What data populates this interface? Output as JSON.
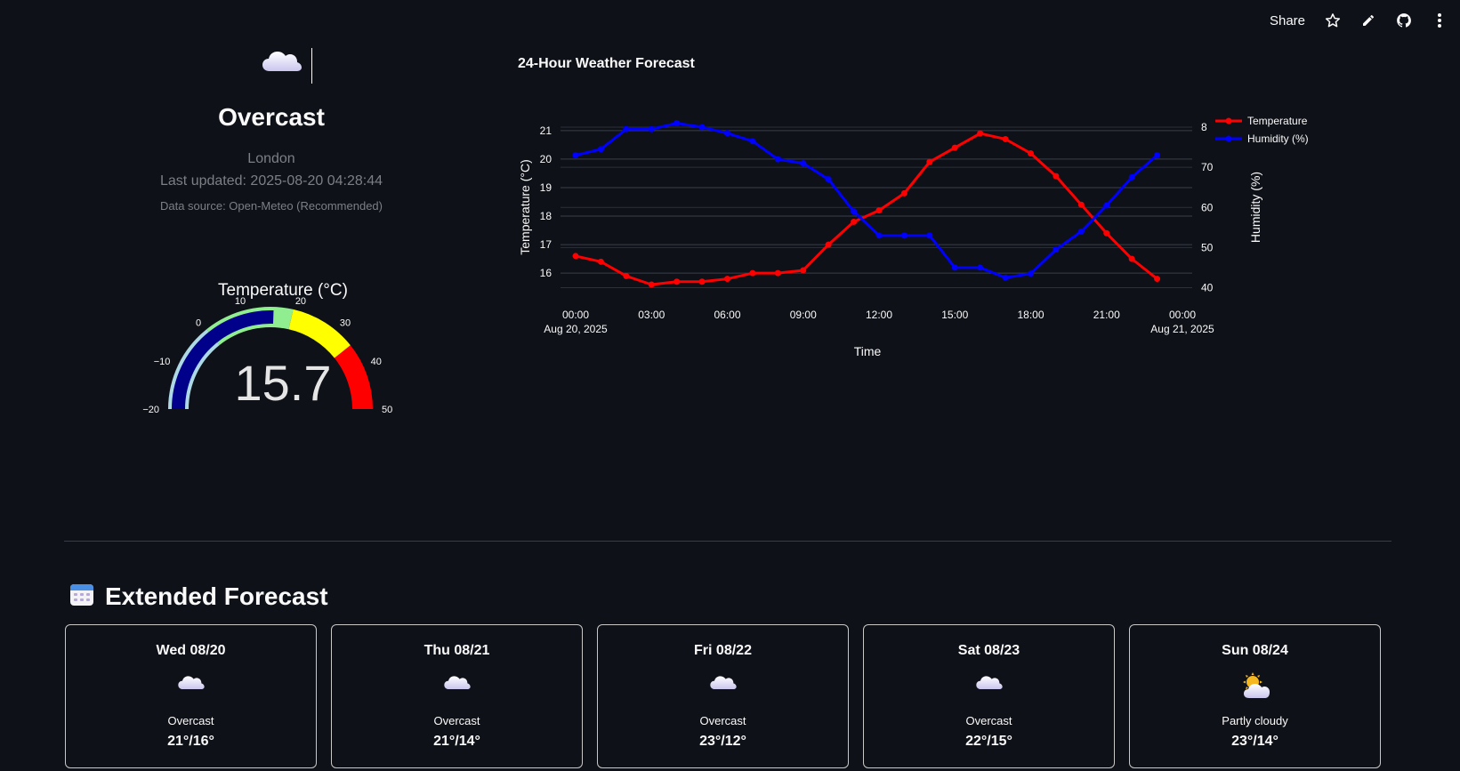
{
  "toolbar": {
    "share_label": "Share",
    "icons": [
      "star-icon",
      "edit-icon",
      "github-icon",
      "more-vert-icon"
    ]
  },
  "current": {
    "icon": "cloud-icon",
    "condition": "Overcast",
    "city": "London",
    "last_updated": "Last updated: 2025-08-20 04:28:44",
    "data_source": "Data source: Open-Meteo (Recommended)"
  },
  "gauge": {
    "title": "Temperature (°C)",
    "value": 15.7,
    "value_label": "15.7",
    "min": -20,
    "max": 50,
    "tick_labels": [
      "−20",
      "−10",
      "0",
      "10",
      "20",
      "30",
      "40",
      "50"
    ],
    "bands": [
      {
        "from": -20,
        "to": 0,
        "color": "#add8e6"
      },
      {
        "from": 0,
        "to": 20,
        "color": "#90ee90"
      },
      {
        "from": 20,
        "to": 35,
        "color": "#ffff00"
      },
      {
        "from": 35,
        "to": 50,
        "color": "#ff0000"
      }
    ],
    "bar_color": "#00008b"
  },
  "chart_title": "24-Hour Weather Forecast",
  "chart_data": {
    "type": "line",
    "title": "24-Hour Weather Forecast",
    "xlabel": "Time",
    "ylabel": "Temperature (°C)",
    "y2label": "Humidity (%)",
    "x": [
      "00:00",
      "01:00",
      "02:00",
      "03:00",
      "04:00",
      "05:00",
      "06:00",
      "07:00",
      "08:00",
      "09:00",
      "10:00",
      "11:00",
      "12:00",
      "13:00",
      "14:00",
      "15:00",
      "16:00",
      "17:00",
      "18:00",
      "19:00",
      "20:00",
      "21:00",
      "22:00",
      "23:00"
    ],
    "x_tick_labels": [
      "00:00",
      "03:00",
      "06:00",
      "09:00",
      "12:00",
      "15:00",
      "18:00",
      "21:00",
      "00:00"
    ],
    "x_tick_sublabels": [
      "Aug 20, 2025",
      "",
      "",
      "",
      "",
      "",
      "",
      "",
      "Aug 21, 2025"
    ],
    "ylim": [
      15.35,
      21.4
    ],
    "y_ticks": [
      16,
      17,
      18,
      19,
      20,
      21
    ],
    "y2lim": [
      39,
      82
    ],
    "y2_ticks": [
      40,
      50,
      60,
      70,
      80
    ],
    "y2_tick_labels": [
      "40",
      "50",
      "60",
      "70",
      "8"
    ],
    "legend_position": "top-right",
    "grid": true,
    "series": [
      {
        "name": "Temperature (°C)",
        "axis": "y",
        "color": "#ff0000",
        "values": [
          16.6,
          16.4,
          15.9,
          15.6,
          15.7,
          15.7,
          15.8,
          16.0,
          16.0,
          16.1,
          17.0,
          17.8,
          18.2,
          18.8,
          19.9,
          20.4,
          20.9,
          20.7,
          20.2,
          19.4,
          18.4,
          17.4,
          16.5,
          15.8
        ]
      },
      {
        "name": "Humidity (%)",
        "axis": "y2",
        "color": "#0000ff",
        "values": [
          73,
          74.5,
          79.5,
          79.5,
          81,
          80,
          78.5,
          76.5,
          72,
          71,
          67,
          59,
          53,
          53,
          53,
          45,
          45,
          42.5,
          43.5,
          49.5,
          54,
          60.5,
          67.5,
          73
        ]
      }
    ]
  },
  "extended": {
    "icon": "calendar-icon",
    "title": "Extended Forecast",
    "days": [
      {
        "day": "Wed 08/20",
        "icon": "cloud-icon",
        "condition": "Overcast",
        "temps": "21°/16°"
      },
      {
        "day": "Thu 08/21",
        "icon": "cloud-icon",
        "condition": "Overcast",
        "temps": "21°/14°"
      },
      {
        "day": "Fri 08/22",
        "icon": "cloud-icon",
        "condition": "Overcast",
        "temps": "23°/12°"
      },
      {
        "day": "Sat 08/23",
        "icon": "cloud-icon",
        "condition": "Overcast",
        "temps": "22°/15°"
      },
      {
        "day": "Sun 08/24",
        "icon": "sun-behind-cloud-icon",
        "condition": "Partly cloudy",
        "temps": "23°/14°"
      }
    ]
  }
}
